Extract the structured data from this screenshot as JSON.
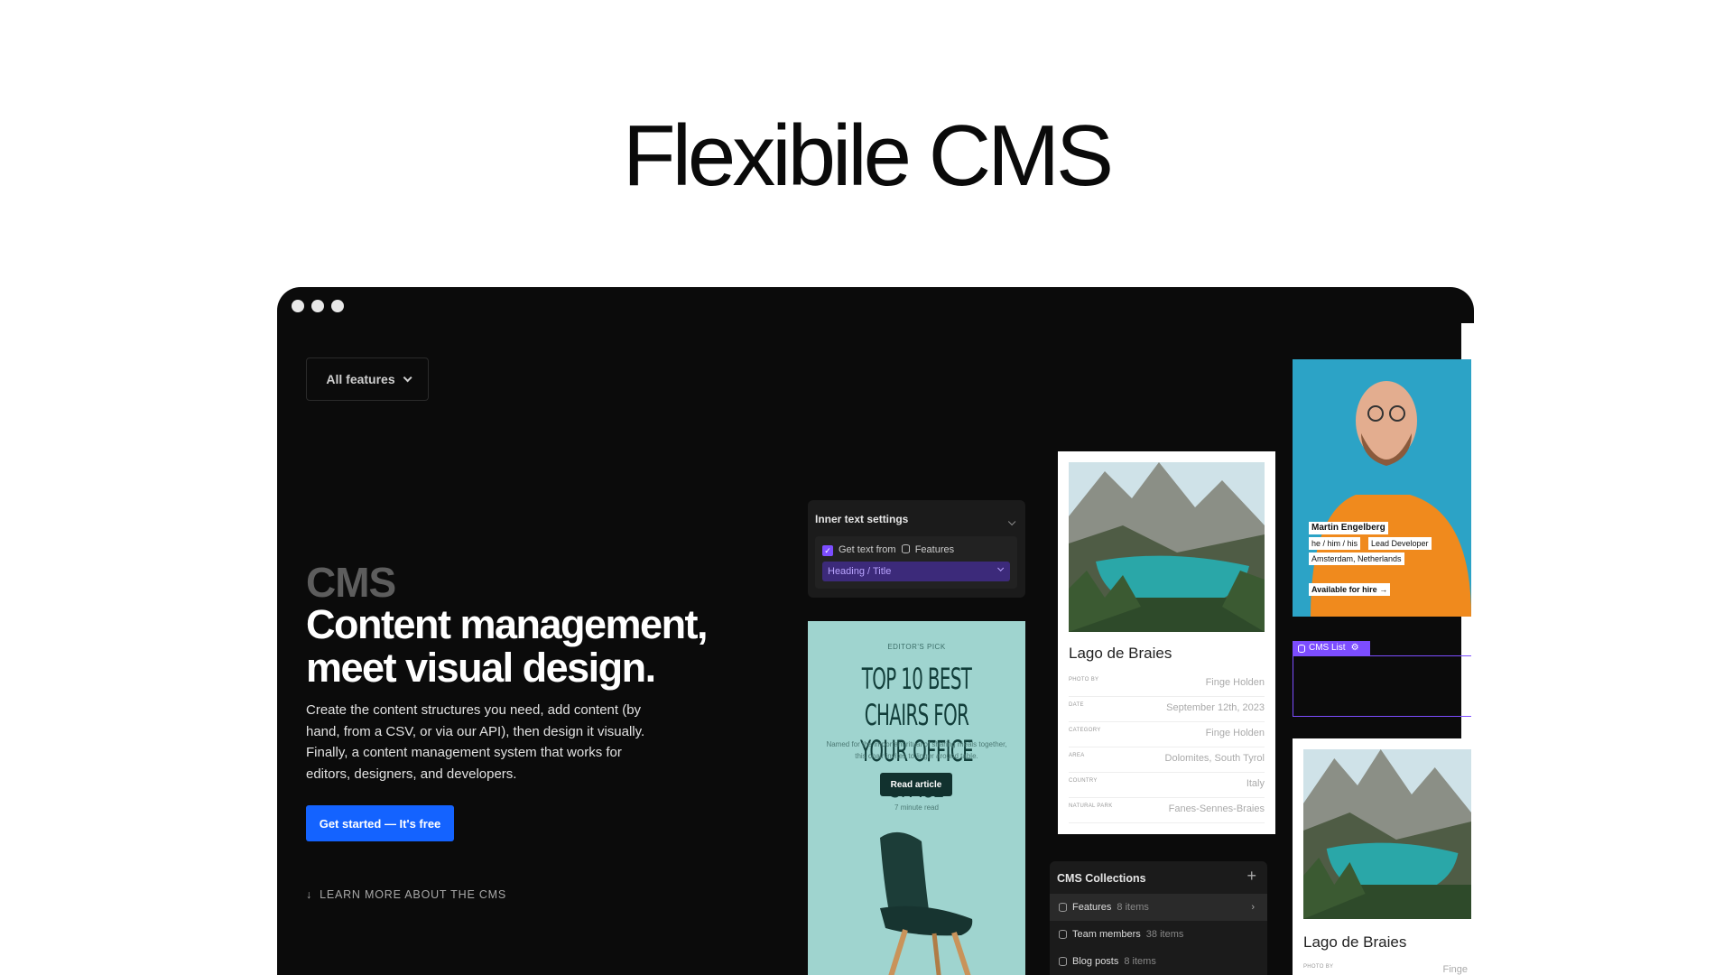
{
  "page": {
    "title": "Flexibile CMS"
  },
  "hero": {
    "features_dropdown": "All features",
    "eyebrow": "CMS",
    "headline": "Content management, meet visual design.",
    "body": "Create the content structures you need, add content (by hand, from a CSV, or via our API), then design it visually. Finally, a content management system that works for editors, designers, and developers.",
    "cta": "Get started — It's free",
    "learn_more": "LEARN MORE ABOUT THE CMS"
  },
  "inner_text_settings": {
    "title": "Inner text settings",
    "get_text_from": "Get text from",
    "source": "Features",
    "field": "Heading / Title"
  },
  "article_card": {
    "tag": "EDITOR'S PICK",
    "title": "TOP 10 BEST CHAIRS FOR YOUR OFFICE SPACE",
    "subtitle": "Named for the important ritual of sharing meals together, this chair invites to linger around table.",
    "button": "Read article",
    "read_time": "7 minute read"
  },
  "location_card": {
    "name": "Lago de Braies",
    "meta": [
      {
        "label": "PHOTO BY",
        "value": "Finge Holden"
      },
      {
        "label": "DATE",
        "value": "September 12th, 2023"
      },
      {
        "label": "CATEGORY",
        "value": "Finge Holden"
      },
      {
        "label": "AREA",
        "value": "Dolomites, South Tyrol"
      },
      {
        "label": "COUNTRY",
        "value": "Italy"
      },
      {
        "label": "NATURAL PARK",
        "value": "Fanes-Sennes-Braies"
      }
    ]
  },
  "cms_collections": {
    "title": "CMS Collections",
    "items": [
      {
        "name": "Features",
        "count": "8 items"
      },
      {
        "name": "Team members",
        "count": "38 items"
      },
      {
        "name": "Blog posts",
        "count": "8 items"
      }
    ]
  },
  "profile_card": {
    "name": "Martin Engelberg",
    "pronouns": "he / him / his",
    "role": "Lead Developer",
    "location": "Amsterdam, Netherlands",
    "availability": "Available for hire →"
  },
  "cms_list": {
    "label": "CMS List"
  },
  "location_card_2": {
    "name": "Lago de Braies",
    "photo_label": "PHOTO BY",
    "photo_value": "Finge"
  }
}
